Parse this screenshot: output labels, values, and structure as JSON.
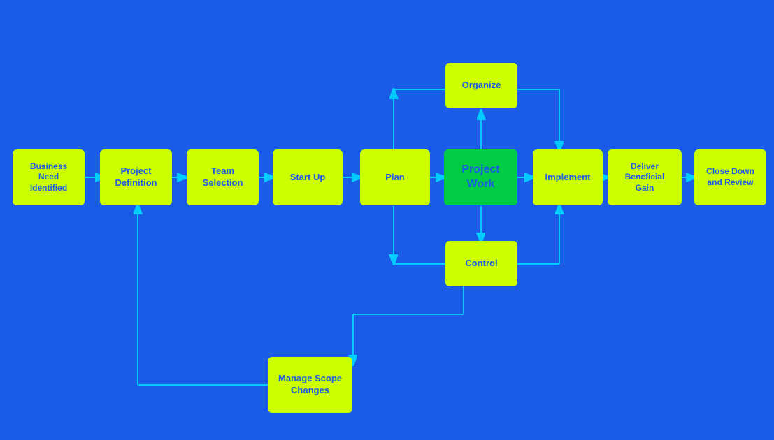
{
  "nodes": {
    "business_need": {
      "label": "Business\nNeed\nIdentified"
    },
    "project_def": {
      "label": "Project\nDefinition"
    },
    "team_selection": {
      "label": "Team\nSelection"
    },
    "start_up": {
      "label": "Start Up"
    },
    "plan": {
      "label": "Plan"
    },
    "project_work": {
      "label": "Project\nWork"
    },
    "implement": {
      "label": "Implement"
    },
    "deliver": {
      "label": "Deliver\nBeneficial\nGain"
    },
    "close_down": {
      "label": "Close Down\nand Review"
    },
    "organize": {
      "label": "Organize"
    },
    "control": {
      "label": "Control"
    },
    "manage_scope": {
      "label": "Manage Scope\nChanges"
    }
  }
}
